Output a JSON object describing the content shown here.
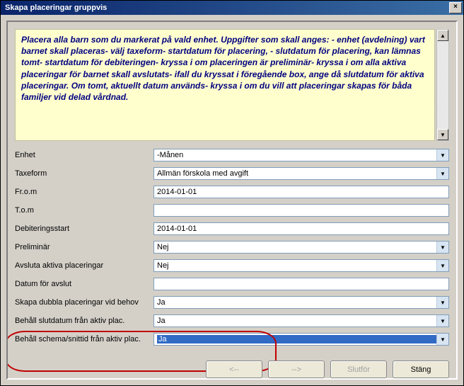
{
  "window": {
    "title": "Skapa placeringar gruppvis",
    "close_label": "×"
  },
  "help": {
    "text": "Placera alla barn som du markerat på vald enhet. Uppgifter som skall anges: - enhet (avdelning) vart barnet skall placeras- välj taxeform- startdatum för placering, - slutdatum för placering, kan lämnas tomt- startdatum för debiteringen- kryssa i om placeringen är preliminär- kryssa i om alla aktiva placeringar för barnet skall avslutats- ifall du kryssat i föregående box, ange då slutdatum för aktiva placeringar. Om tomt, aktuellt datum används- kryssa i om du vill att placeringar skapas för båda familjer vid delad vårdnad."
  },
  "form": {
    "enhet_label": "Enhet",
    "enhet_value": "    -Månen",
    "taxeform_label": "Taxeform",
    "taxeform_value": "Allmän förskola med avgift",
    "from_label": "Fr.o.m",
    "from_value": "2014-01-01",
    "tom_label": "T.o.m",
    "tom_value": "",
    "debstart_label": "Debiteringsstart",
    "debstart_value": "2014-01-01",
    "prelim_label": "Preliminär",
    "prelim_value": "Nej",
    "avsluta_label": "Avsluta aktiva placeringar",
    "avsluta_value": "Nej",
    "datavslut_label": "Datum för avslut",
    "datavslut_value": "",
    "dubbla_label": "Skapa dubbla placeringar vid behov",
    "dubbla_value": "Ja",
    "behallslut_label": "Behåll slutdatum från aktiv plac.",
    "behallslut_value": "Ja",
    "behallschema_label": "Behåll schema/snittid från aktiv plac.",
    "behallschema_value": "Ja"
  },
  "buttons": {
    "back": "<--",
    "next": "-->",
    "finish": "Slutför",
    "close": "Stäng"
  }
}
